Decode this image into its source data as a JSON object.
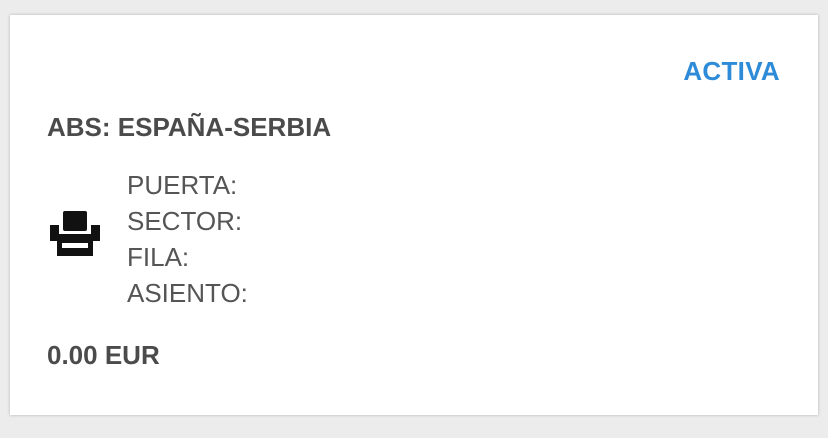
{
  "ticket": {
    "status": "ACTIVA",
    "event_title": "ABS: ESPAÑA-SERBIA",
    "seat_icon": "seat-icon",
    "details": {
      "gate_label": "PUERTA:",
      "sector_label": "SECTOR:",
      "row_label": "FILA:",
      "seat_label": "ASIENTO:"
    },
    "price": "0.00 EUR"
  },
  "colors": {
    "status_accent": "#2e8bd7",
    "text_primary": "#4b4b4b",
    "text_secondary": "#555555",
    "card_background": "#ffffff",
    "page_background": "#ececec"
  }
}
